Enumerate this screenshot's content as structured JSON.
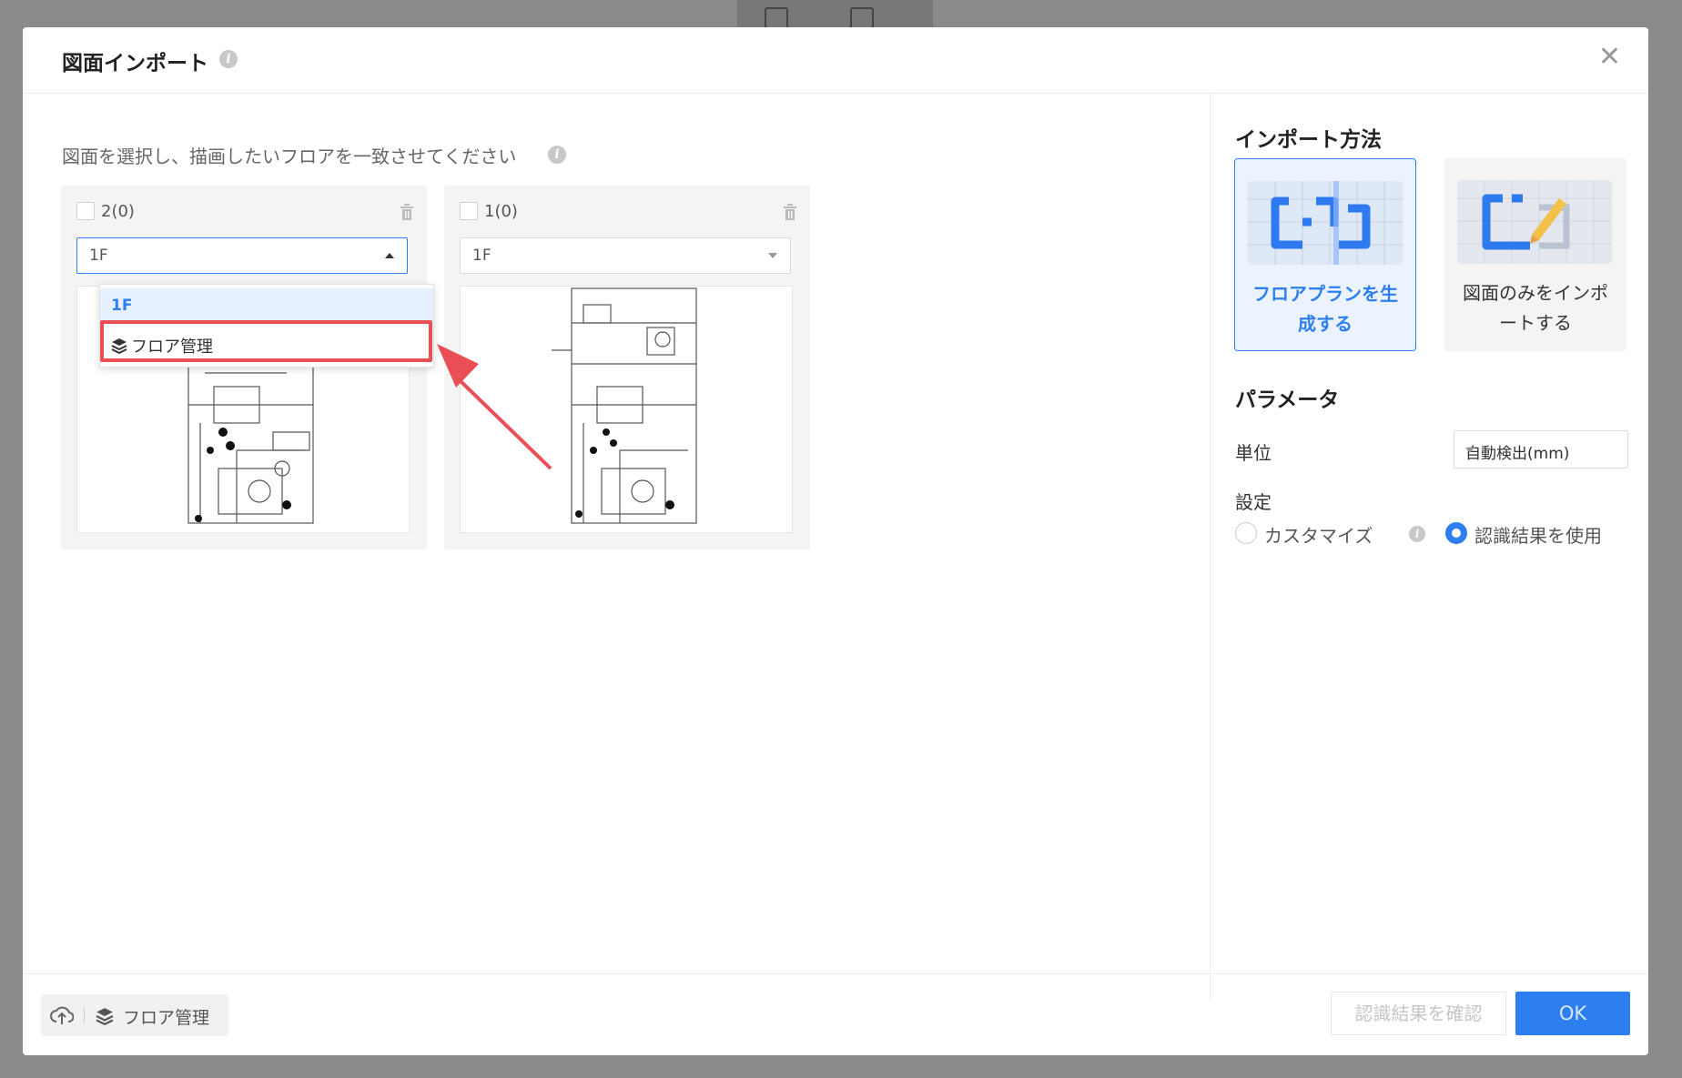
{
  "dialog": {
    "title": "図面インポート",
    "close_icon": "close-icon"
  },
  "left": {
    "instruction": "図面を選択し、描画したいフロアを一致させてください",
    "cards": [
      {
        "label": "2(0)",
        "floor_value": "1F",
        "dropdown_open": true
      },
      {
        "label": "1(0)",
        "floor_value": "1F",
        "dropdown_open": false
      }
    ],
    "dropdown": {
      "options": [
        "1F"
      ],
      "manage_label": "フロア管理"
    }
  },
  "right": {
    "import_method_title": "インポート方法",
    "methods": [
      {
        "label_line1": "フロアプランを生",
        "label_line2": "成する",
        "selected": true
      },
      {
        "label_line1": "図面のみをインポ",
        "label_line2": "ートする",
        "selected": false
      }
    ],
    "params_title": "パラメータ",
    "unit_label": "単位",
    "unit_value": "自動検出(mm)",
    "setting_label": "設定",
    "radio_custom": "カスタマイズ",
    "radio_recognition": "認識結果を使用",
    "selected_radio": "recognition"
  },
  "footer": {
    "floor_manage": "フロア管理",
    "confirm_button": "認識結果を確認",
    "ok_button": "OK"
  },
  "colors": {
    "accent": "#2d7ff0",
    "highlight": "#e94f55"
  }
}
